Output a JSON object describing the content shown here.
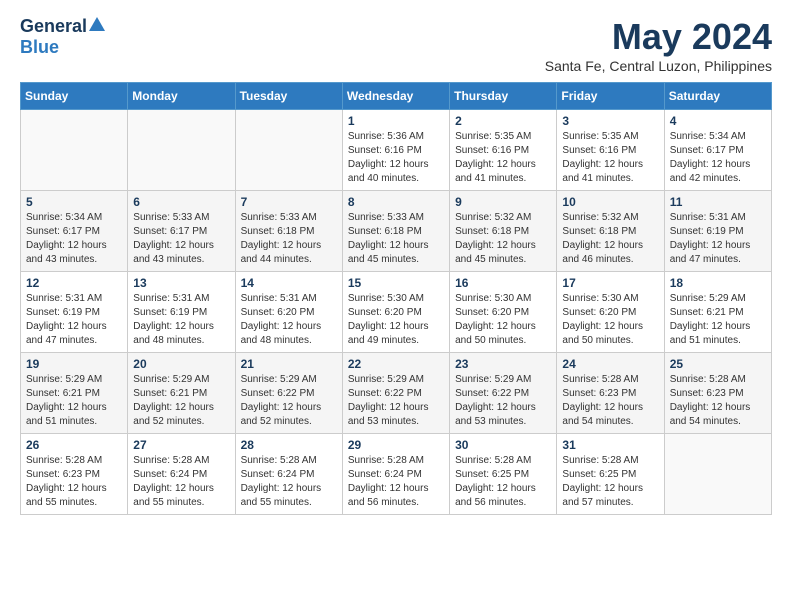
{
  "header": {
    "logo_general": "General",
    "logo_blue": "Blue",
    "title": "May 2024",
    "location": "Santa Fe, Central Luzon, Philippines"
  },
  "weekdays": [
    "Sunday",
    "Monday",
    "Tuesday",
    "Wednesday",
    "Thursday",
    "Friday",
    "Saturday"
  ],
  "weeks": [
    [
      {
        "day": "",
        "sunrise": "",
        "sunset": "",
        "daylight": ""
      },
      {
        "day": "",
        "sunrise": "",
        "sunset": "",
        "daylight": ""
      },
      {
        "day": "",
        "sunrise": "",
        "sunset": "",
        "daylight": ""
      },
      {
        "day": "1",
        "sunrise": "Sunrise: 5:36 AM",
        "sunset": "Sunset: 6:16 PM",
        "daylight": "Daylight: 12 hours and 40 minutes."
      },
      {
        "day": "2",
        "sunrise": "Sunrise: 5:35 AM",
        "sunset": "Sunset: 6:16 PM",
        "daylight": "Daylight: 12 hours and 41 minutes."
      },
      {
        "day": "3",
        "sunrise": "Sunrise: 5:35 AM",
        "sunset": "Sunset: 6:16 PM",
        "daylight": "Daylight: 12 hours and 41 minutes."
      },
      {
        "day": "4",
        "sunrise": "Sunrise: 5:34 AM",
        "sunset": "Sunset: 6:17 PM",
        "daylight": "Daylight: 12 hours and 42 minutes."
      }
    ],
    [
      {
        "day": "5",
        "sunrise": "Sunrise: 5:34 AM",
        "sunset": "Sunset: 6:17 PM",
        "daylight": "Daylight: 12 hours and 43 minutes."
      },
      {
        "day": "6",
        "sunrise": "Sunrise: 5:33 AM",
        "sunset": "Sunset: 6:17 PM",
        "daylight": "Daylight: 12 hours and 43 minutes."
      },
      {
        "day": "7",
        "sunrise": "Sunrise: 5:33 AM",
        "sunset": "Sunset: 6:18 PM",
        "daylight": "Daylight: 12 hours and 44 minutes."
      },
      {
        "day": "8",
        "sunrise": "Sunrise: 5:33 AM",
        "sunset": "Sunset: 6:18 PM",
        "daylight": "Daylight: 12 hours and 45 minutes."
      },
      {
        "day": "9",
        "sunrise": "Sunrise: 5:32 AM",
        "sunset": "Sunset: 6:18 PM",
        "daylight": "Daylight: 12 hours and 45 minutes."
      },
      {
        "day": "10",
        "sunrise": "Sunrise: 5:32 AM",
        "sunset": "Sunset: 6:18 PM",
        "daylight": "Daylight: 12 hours and 46 minutes."
      },
      {
        "day": "11",
        "sunrise": "Sunrise: 5:31 AM",
        "sunset": "Sunset: 6:19 PM",
        "daylight": "Daylight: 12 hours and 47 minutes."
      }
    ],
    [
      {
        "day": "12",
        "sunrise": "Sunrise: 5:31 AM",
        "sunset": "Sunset: 6:19 PM",
        "daylight": "Daylight: 12 hours and 47 minutes."
      },
      {
        "day": "13",
        "sunrise": "Sunrise: 5:31 AM",
        "sunset": "Sunset: 6:19 PM",
        "daylight": "Daylight: 12 hours and 48 minutes."
      },
      {
        "day": "14",
        "sunrise": "Sunrise: 5:31 AM",
        "sunset": "Sunset: 6:20 PM",
        "daylight": "Daylight: 12 hours and 48 minutes."
      },
      {
        "day": "15",
        "sunrise": "Sunrise: 5:30 AM",
        "sunset": "Sunset: 6:20 PM",
        "daylight": "Daylight: 12 hours and 49 minutes."
      },
      {
        "day": "16",
        "sunrise": "Sunrise: 5:30 AM",
        "sunset": "Sunset: 6:20 PM",
        "daylight": "Daylight: 12 hours and 50 minutes."
      },
      {
        "day": "17",
        "sunrise": "Sunrise: 5:30 AM",
        "sunset": "Sunset: 6:20 PM",
        "daylight": "Daylight: 12 hours and 50 minutes."
      },
      {
        "day": "18",
        "sunrise": "Sunrise: 5:29 AM",
        "sunset": "Sunset: 6:21 PM",
        "daylight": "Daylight: 12 hours and 51 minutes."
      }
    ],
    [
      {
        "day": "19",
        "sunrise": "Sunrise: 5:29 AM",
        "sunset": "Sunset: 6:21 PM",
        "daylight": "Daylight: 12 hours and 51 minutes."
      },
      {
        "day": "20",
        "sunrise": "Sunrise: 5:29 AM",
        "sunset": "Sunset: 6:21 PM",
        "daylight": "Daylight: 12 hours and 52 minutes."
      },
      {
        "day": "21",
        "sunrise": "Sunrise: 5:29 AM",
        "sunset": "Sunset: 6:22 PM",
        "daylight": "Daylight: 12 hours and 52 minutes."
      },
      {
        "day": "22",
        "sunrise": "Sunrise: 5:29 AM",
        "sunset": "Sunset: 6:22 PM",
        "daylight": "Daylight: 12 hours and 53 minutes."
      },
      {
        "day": "23",
        "sunrise": "Sunrise: 5:29 AM",
        "sunset": "Sunset: 6:22 PM",
        "daylight": "Daylight: 12 hours and 53 minutes."
      },
      {
        "day": "24",
        "sunrise": "Sunrise: 5:28 AM",
        "sunset": "Sunset: 6:23 PM",
        "daylight": "Daylight: 12 hours and 54 minutes."
      },
      {
        "day": "25",
        "sunrise": "Sunrise: 5:28 AM",
        "sunset": "Sunset: 6:23 PM",
        "daylight": "Daylight: 12 hours and 54 minutes."
      }
    ],
    [
      {
        "day": "26",
        "sunrise": "Sunrise: 5:28 AM",
        "sunset": "Sunset: 6:23 PM",
        "daylight": "Daylight: 12 hours and 55 minutes."
      },
      {
        "day": "27",
        "sunrise": "Sunrise: 5:28 AM",
        "sunset": "Sunset: 6:24 PM",
        "daylight": "Daylight: 12 hours and 55 minutes."
      },
      {
        "day": "28",
        "sunrise": "Sunrise: 5:28 AM",
        "sunset": "Sunset: 6:24 PM",
        "daylight": "Daylight: 12 hours and 55 minutes."
      },
      {
        "day": "29",
        "sunrise": "Sunrise: 5:28 AM",
        "sunset": "Sunset: 6:24 PM",
        "daylight": "Daylight: 12 hours and 56 minutes."
      },
      {
        "day": "30",
        "sunrise": "Sunrise: 5:28 AM",
        "sunset": "Sunset: 6:25 PM",
        "daylight": "Daylight: 12 hours and 56 minutes."
      },
      {
        "day": "31",
        "sunrise": "Sunrise: 5:28 AM",
        "sunset": "Sunset: 6:25 PM",
        "daylight": "Daylight: 12 hours and 57 minutes."
      },
      {
        "day": "",
        "sunrise": "",
        "sunset": "",
        "daylight": ""
      }
    ]
  ]
}
